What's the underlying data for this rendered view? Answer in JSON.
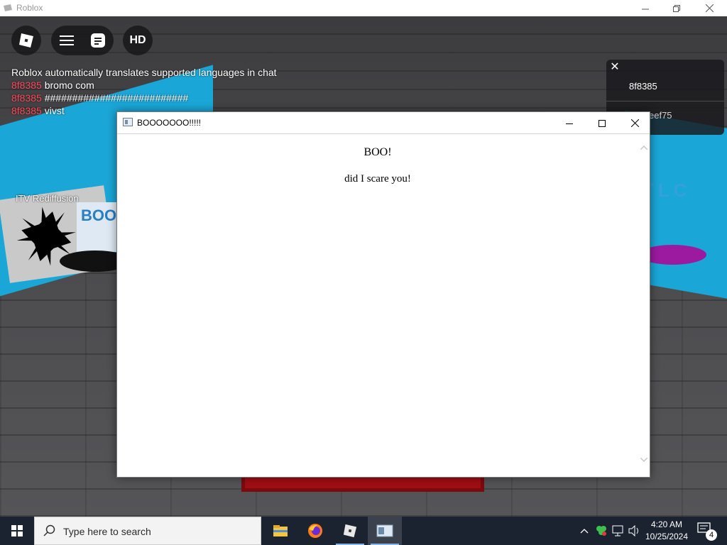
{
  "window": {
    "title": "Roblox",
    "minimize_icon": "minimize-icon",
    "restore_icon": "restore-icon",
    "close_icon": "close-icon"
  },
  "hud": {
    "menu_icon": "roblox-logo-icon",
    "hamburger_icon": "hamburger-menu-icon",
    "chat_icon": "chat-icon",
    "hd_label": "HD"
  },
  "chat": {
    "notice": "Roblox automatically translates supported languages in chat",
    "messages": [
      {
        "user": "8f8385",
        "text": "bromo com"
      },
      {
        "user": "8f8385",
        "text": "##########################"
      },
      {
        "user": "8f8385",
        "text": "vivst"
      }
    ]
  },
  "players": {
    "close_label": "✕",
    "list": [
      "8f8385",
      "eef75"
    ]
  },
  "scene": {
    "sign_text": "ITV Rediffusion",
    "boom_text": "BOOM",
    "right_sign_text": "TLC"
  },
  "popup": {
    "title": "BOOOOOOO!!!!!",
    "heading": "BOO!",
    "message": "did I scare you!"
  },
  "taskbar": {
    "search_placeholder": "Type here to search",
    "apps": [
      "file-explorer-icon",
      "firefox-icon",
      "roblox-icon",
      "app-window-icon"
    ],
    "time": "4:20 AM",
    "date": "10/25/2024",
    "notification_count": "4"
  },
  "colors": {
    "taskbar": "#1b2330",
    "chat_username": "#ff4a5a",
    "scene_blue": "#1aa6d6"
  }
}
